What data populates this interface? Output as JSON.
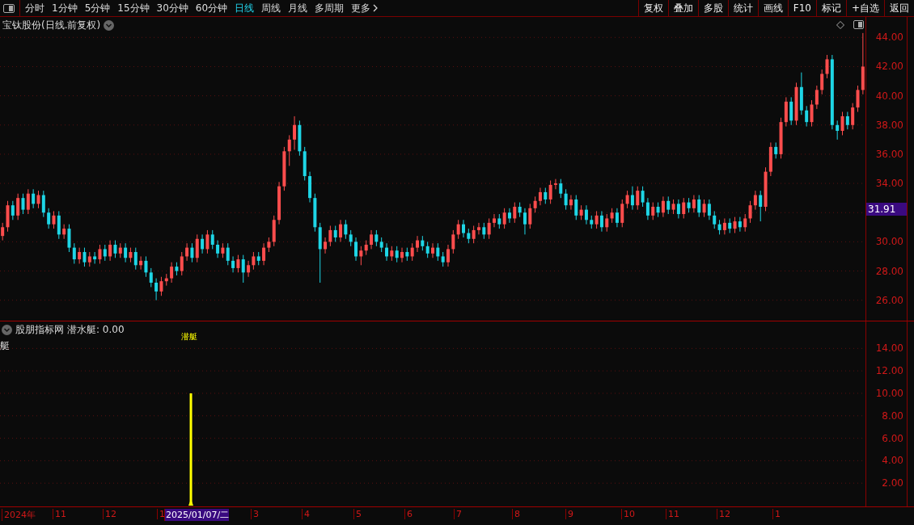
{
  "toolbar": {
    "periods": [
      {
        "label": "分时",
        "selected": false
      },
      {
        "label": "1分钟",
        "selected": false
      },
      {
        "label": "5分钟",
        "selected": false
      },
      {
        "label": "15分钟",
        "selected": false
      },
      {
        "label": "30分钟",
        "selected": false
      },
      {
        "label": "60分钟",
        "selected": false
      },
      {
        "label": "日线",
        "selected": true
      },
      {
        "label": "周线",
        "selected": false
      },
      {
        "label": "月线",
        "selected": false
      },
      {
        "label": "多周期",
        "selected": false
      },
      {
        "label": "更多",
        "selected": false
      }
    ],
    "buttons": [
      "复权",
      "叠加",
      "多股",
      "统计",
      "画线",
      "F10",
      "标记",
      "+自选",
      "返回"
    ]
  },
  "main_chart": {
    "title": "宝钛股份(日线.前复权)",
    "price_tag": "31.91",
    "chart_data": {
      "type": "candlestick",
      "grid": true,
      "ylim": [
        24.6,
        45.4
      ],
      "categories": [
        null,
        null,
        null,
        null,
        null,
        null,
        null,
        null,
        null,
        null,
        null,
        null,
        null,
        null,
        null,
        null,
        null,
        null,
        null,
        null,
        null,
        null,
        null,
        null,
        null,
        null,
        null,
        null,
        null,
        null,
        null,
        null,
        null,
        null,
        null,
        null,
        null,
        null,
        null,
        null,
        null,
        null,
        null,
        null,
        null,
        null,
        null,
        null,
        null,
        null,
        null,
        null,
        null,
        null,
        null,
        null,
        null,
        null,
        null,
        null,
        null,
        null,
        null,
        null,
        null,
        null,
        null,
        null,
        null,
        null,
        null,
        null,
        null,
        null,
        null,
        null,
        null,
        null,
        null,
        null,
        null,
        null,
        null,
        null,
        null,
        null,
        null,
        null,
        null,
        null,
        null,
        null,
        null,
        null,
        null,
        null,
        null,
        null,
        null,
        null,
        null,
        null,
        null,
        null,
        null,
        null,
        null,
        null,
        null,
        null,
        null,
        null,
        null,
        null,
        null,
        null,
        null,
        null,
        null,
        null,
        null,
        null,
        null,
        null,
        null,
        null,
        null,
        null,
        null,
        null,
        null,
        null,
        null,
        null,
        null,
        null,
        null,
        null,
        null,
        null,
        null,
        null,
        null,
        null,
        null,
        null,
        null,
        null,
        null,
        null,
        null,
        null,
        null,
        null,
        null,
        null,
        null,
        null,
        null,
        null,
        null,
        null,
        null,
        null,
        null,
        null,
        null,
        null,
        null
      ],
      "yticks": [
        {
          "value": 44,
          "label": "44.00"
        },
        {
          "value": 42,
          "label": "42.00"
        },
        {
          "value": 40,
          "label": "40.00"
        },
        {
          "value": 38,
          "label": "38.00"
        },
        {
          "value": 36,
          "label": "36.00"
        },
        {
          "value": 34,
          "label": "34.00"
        },
        {
          "value": 30,
          "label": "30.00"
        },
        {
          "value": 28,
          "label": "28.00"
        },
        {
          "value": 26,
          "label": "26.00"
        }
      ],
      "ohlc": [
        [
          30.4,
          31.3,
          30.1,
          31.0
        ],
        [
          31.0,
          32.8,
          30.7,
          32.5
        ],
        [
          32.5,
          32.8,
          31.5,
          31.8
        ],
        [
          31.8,
          33.3,
          31.5,
          33.0
        ],
        [
          33.0,
          33.3,
          31.9,
          32.2
        ],
        [
          32.2,
          33.6,
          31.9,
          33.3
        ],
        [
          33.3,
          33.6,
          32.3,
          32.6
        ],
        [
          32.6,
          33.5,
          32.3,
          33.2
        ],
        [
          33.2,
          33.5,
          31.7,
          32.0
        ],
        [
          32.0,
          32.3,
          30.9,
          31.2
        ],
        [
          31.2,
          32.1,
          30.9,
          31.8
        ],
        [
          31.8,
          32.1,
          30.2,
          30.5
        ],
        [
          30.5,
          31.2,
          30.2,
          30.9
        ],
        [
          30.9,
          31.2,
          29.3,
          29.6
        ],
        [
          29.6,
          29.9,
          28.5,
          28.8
        ],
        [
          28.8,
          29.6,
          28.5,
          29.3
        ],
        [
          29.3,
          29.6,
          28.3,
          28.6
        ],
        [
          28.6,
          29.3,
          28.3,
          29.0
        ],
        [
          29.0,
          29.3,
          28.5,
          28.8
        ],
        [
          28.8,
          29.8,
          28.5,
          29.5
        ],
        [
          29.5,
          29.8,
          28.7,
          29.0
        ],
        [
          29.0,
          30.1,
          28.7,
          29.8
        ],
        [
          29.8,
          30.1,
          28.9,
          29.2
        ],
        [
          29.2,
          29.9,
          28.9,
          29.6
        ],
        [
          29.6,
          29.9,
          28.6,
          28.9
        ],
        [
          28.9,
          29.6,
          28.6,
          29.3
        ],
        [
          29.3,
          29.6,
          28.1,
          28.4
        ],
        [
          28.4,
          29.0,
          28.1,
          28.7
        ],
        [
          28.7,
          29.0,
          27.6,
          27.9
        ],
        [
          27.9,
          28.2,
          26.9,
          27.2
        ],
        [
          27.2,
          27.5,
          26.0,
          26.6
        ],
        [
          26.6,
          27.6,
          26.3,
          27.3
        ],
        [
          27.3,
          27.8,
          27.0,
          27.5
        ],
        [
          27.5,
          28.6,
          27.2,
          28.3
        ],
        [
          28.3,
          28.6,
          27.7,
          28.0
        ],
        [
          28.0,
          29.3,
          27.7,
          29.0
        ],
        [
          29.0,
          29.9,
          28.7,
          29.6
        ],
        [
          29.6,
          29.9,
          28.6,
          28.9
        ],
        [
          28.9,
          30.5,
          28.6,
          30.2
        ],
        [
          30.2,
          30.5,
          29.2,
          29.5
        ],
        [
          29.5,
          30.8,
          29.2,
          30.5
        ],
        [
          30.5,
          30.8,
          29.5,
          29.8
        ],
        [
          29.8,
          30.1,
          28.9,
          29.2
        ],
        [
          29.2,
          29.9,
          28.9,
          29.6
        ],
        [
          29.6,
          29.9,
          28.4,
          28.7
        ],
        [
          28.7,
          29.0,
          27.9,
          28.2
        ],
        [
          28.2,
          29.1,
          27.9,
          28.8
        ],
        [
          28.8,
          29.1,
          27.2,
          27.9
        ],
        [
          27.9,
          28.7,
          27.6,
          28.4
        ],
        [
          28.4,
          29.3,
          28.1,
          29.0
        ],
        [
          29.0,
          29.3,
          28.4,
          28.7
        ],
        [
          28.7,
          29.9,
          28.4,
          29.6
        ],
        [
          29.6,
          30.3,
          29.3,
          30.0
        ],
        [
          30.0,
          31.8,
          29.7,
          31.5
        ],
        [
          31.5,
          34.1,
          31.2,
          33.8
        ],
        [
          33.8,
          36.5,
          33.5,
          36.2
        ],
        [
          36.2,
          37.3,
          35.2,
          37.0
        ],
        [
          37.0,
          38.6,
          36.3,
          38.0
        ],
        [
          38.0,
          38.3,
          35.9,
          36.2
        ],
        [
          36.2,
          36.5,
          34.2,
          34.5
        ],
        [
          34.5,
          34.8,
          32.7,
          33.0
        ],
        [
          33.0,
          33.3,
          30.7,
          31.0
        ],
        [
          31.0,
          31.3,
          27.2,
          29.5
        ],
        [
          29.5,
          30.3,
          29.2,
          30.0
        ],
        [
          30.0,
          31.1,
          29.7,
          30.8
        ],
        [
          30.8,
          31.1,
          30.0,
          30.3
        ],
        [
          30.3,
          31.5,
          30.0,
          31.2
        ],
        [
          31.2,
          31.5,
          30.2,
          30.5
        ],
        [
          30.5,
          30.8,
          29.7,
          30.0
        ],
        [
          30.0,
          30.3,
          28.7,
          29.0
        ],
        [
          29.0,
          29.7,
          28.4,
          29.4
        ],
        [
          29.4,
          30.1,
          29.1,
          29.8
        ],
        [
          29.8,
          30.8,
          29.5,
          30.5
        ],
        [
          30.5,
          30.8,
          29.7,
          30.0
        ],
        [
          30.0,
          30.3,
          29.3,
          29.6
        ],
        [
          29.6,
          29.9,
          28.7,
          29.0
        ],
        [
          29.0,
          29.7,
          28.7,
          29.4
        ],
        [
          29.4,
          29.7,
          28.6,
          28.9
        ],
        [
          28.9,
          29.6,
          28.6,
          29.3
        ],
        [
          29.3,
          29.6,
          28.7,
          29.0
        ],
        [
          29.0,
          29.9,
          28.7,
          29.6
        ],
        [
          29.6,
          30.4,
          29.3,
          30.1
        ],
        [
          30.1,
          30.4,
          29.4,
          29.7
        ],
        [
          29.7,
          30.0,
          28.9,
          29.2
        ],
        [
          29.2,
          29.9,
          28.9,
          29.6
        ],
        [
          29.6,
          29.9,
          28.7,
          29.0
        ],
        [
          29.0,
          29.3,
          28.3,
          28.6
        ],
        [
          28.6,
          29.8,
          28.3,
          29.5
        ],
        [
          29.5,
          30.8,
          29.2,
          30.5
        ],
        [
          30.5,
          31.5,
          30.2,
          31.2
        ],
        [
          31.2,
          31.5,
          30.3,
          30.6
        ],
        [
          30.6,
          30.9,
          29.9,
          30.2
        ],
        [
          30.2,
          31.1,
          29.9,
          30.8
        ],
        [
          30.8,
          31.3,
          30.5,
          31.0
        ],
        [
          31.0,
          31.3,
          30.2,
          30.5
        ],
        [
          30.5,
          31.6,
          30.2,
          31.3
        ],
        [
          31.3,
          31.9,
          31.0,
          31.6
        ],
        [
          31.6,
          31.9,
          30.9,
          31.2
        ],
        [
          31.2,
          32.3,
          30.9,
          32.0
        ],
        [
          32.0,
          32.3,
          31.3,
          31.6
        ],
        [
          31.6,
          32.7,
          31.3,
          32.4
        ],
        [
          32.4,
          32.7,
          31.7,
          32.0
        ],
        [
          32.0,
          32.3,
          30.5,
          31.2
        ],
        [
          31.2,
          32.6,
          30.9,
          32.3
        ],
        [
          32.3,
          33.1,
          32.0,
          32.8
        ],
        [
          32.8,
          33.7,
          32.5,
          33.4
        ],
        [
          33.4,
          33.7,
          32.6,
          32.9
        ],
        [
          32.9,
          34.2,
          32.6,
          33.9
        ],
        [
          33.9,
          34.3,
          33.6,
          34.0
        ],
        [
          34.0,
          34.3,
          33.0,
          33.3
        ],
        [
          33.3,
          33.6,
          32.2,
          32.5
        ],
        [
          32.5,
          33.2,
          32.2,
          32.9
        ],
        [
          32.9,
          33.2,
          31.5,
          31.8
        ],
        [
          31.8,
          32.5,
          31.5,
          32.2
        ],
        [
          32.2,
          32.5,
          31.2,
          31.5
        ],
        [
          31.5,
          31.8,
          30.9,
          31.2
        ],
        [
          31.2,
          32.1,
          30.9,
          31.8
        ],
        [
          31.8,
          32.1,
          30.7,
          31.0
        ],
        [
          31.0,
          31.9,
          30.7,
          31.6
        ],
        [
          31.6,
          32.3,
          31.3,
          32.0
        ],
        [
          32.0,
          32.3,
          31.0,
          31.3
        ],
        [
          31.3,
          32.9,
          31.0,
          32.6
        ],
        [
          32.6,
          33.5,
          32.3,
          33.2
        ],
        [
          33.2,
          33.8,
          32.2,
          32.5
        ],
        [
          32.5,
          33.8,
          32.2,
          33.5
        ],
        [
          33.5,
          33.8,
          32.4,
          32.7
        ],
        [
          32.7,
          33.0,
          31.5,
          31.8
        ],
        [
          31.8,
          32.7,
          31.5,
          32.4
        ],
        [
          32.4,
          32.7,
          31.7,
          32.0
        ],
        [
          32.0,
          33.1,
          31.7,
          32.8
        ],
        [
          32.8,
          33.1,
          31.9,
          32.2
        ],
        [
          32.2,
          32.9,
          31.9,
          32.6
        ],
        [
          32.6,
          32.9,
          31.6,
          31.9
        ],
        [
          31.9,
          33.0,
          31.6,
          32.7
        ],
        [
          32.7,
          33.0,
          32.0,
          32.3
        ],
        [
          32.3,
          33.2,
          32.0,
          32.9
        ],
        [
          32.9,
          33.2,
          31.7,
          32.0
        ],
        [
          32.0,
          32.9,
          31.7,
          32.6
        ],
        [
          32.6,
          32.9,
          31.5,
          31.8
        ],
        [
          31.8,
          32.1,
          30.9,
          31.2
        ],
        [
          31.2,
          31.5,
          30.5,
          30.8
        ],
        [
          30.8,
          31.6,
          30.5,
          31.3
        ],
        [
          31.3,
          31.6,
          30.6,
          30.9
        ],
        [
          30.9,
          31.7,
          30.6,
          31.4
        ],
        [
          31.4,
          31.7,
          30.7,
          31.0
        ],
        [
          31.0,
          31.9,
          30.7,
          31.6
        ],
        [
          31.6,
          32.8,
          31.3,
          32.5
        ],
        [
          32.5,
          33.5,
          32.2,
          33.2
        ],
        [
          33.2,
          33.5,
          31.4,
          32.4
        ],
        [
          32.4,
          35.1,
          32.1,
          34.8
        ],
        [
          34.8,
          36.8,
          34.5,
          36.5
        ],
        [
          36.5,
          36.8,
          35.7,
          36.0
        ],
        [
          36.0,
          38.5,
          35.7,
          38.2
        ],
        [
          38.2,
          39.9,
          37.9,
          39.6
        ],
        [
          39.6,
          39.9,
          38.0,
          38.3
        ],
        [
          38.3,
          40.9,
          38.0,
          40.6
        ],
        [
          40.6,
          41.6,
          38.7,
          39.0
        ],
        [
          39.0,
          39.3,
          37.9,
          38.2
        ],
        [
          38.2,
          39.7,
          37.9,
          39.4
        ],
        [
          39.4,
          40.7,
          39.1,
          40.4
        ],
        [
          40.4,
          41.8,
          40.1,
          41.5
        ],
        [
          41.5,
          42.8,
          41.2,
          42.5
        ],
        [
          42.5,
          42.8,
          37.7,
          38.0
        ],
        [
          38.0,
          38.3,
          37.0,
          37.6
        ],
        [
          37.6,
          38.9,
          37.3,
          38.6
        ],
        [
          38.6,
          38.9,
          37.7,
          38.0
        ],
        [
          38.0,
          39.5,
          37.7,
          39.2
        ],
        [
          39.2,
          40.7,
          38.9,
          40.4
        ],
        [
          40.4,
          44.3,
          40.1,
          42.0
        ]
      ]
    }
  },
  "indicator": {
    "title": "股朋指标网",
    "reading": "潜水艇: 0.00",
    "side_label": "艇",
    "signal_label": "潜艇",
    "chart_data": {
      "type": "bar",
      "categories": [
        null,
        null,
        null,
        null,
        null,
        null,
        null,
        null,
        null,
        null,
        null,
        null,
        null,
        null,
        null,
        null,
        null,
        null,
        null,
        null,
        null,
        null,
        null,
        null,
        null,
        null,
        null,
        null,
        null,
        null,
        null,
        null,
        null,
        null,
        null,
        null,
        null,
        null,
        null,
        null,
        null,
        null,
        null,
        null,
        null,
        null,
        null,
        null,
        null,
        null,
        null,
        null,
        null,
        null,
        null,
        null,
        null,
        null,
        null,
        null,
        null,
        null,
        null,
        null,
        null,
        null,
        null,
        null,
        null,
        null,
        null,
        null,
        null,
        null,
        null,
        null,
        null,
        null,
        null,
        null,
        null,
        null,
        null,
        null,
        null,
        null,
        null,
        null,
        null,
        null,
        null,
        null,
        null,
        null,
        null,
        null,
        null,
        null,
        null,
        null,
        null,
        null,
        null,
        null,
        null,
        null,
        null,
        null,
        null,
        null,
        null,
        null,
        null,
        null,
        null,
        null,
        null,
        null,
        null,
        null,
        null,
        null,
        null,
        null,
        null,
        null,
        null,
        null,
        null,
        null,
        null,
        null,
        null,
        null,
        null,
        null,
        null,
        null,
        null,
        null,
        null,
        null,
        null,
        null,
        null,
        null,
        null,
        null,
        null,
        null,
        null,
        null,
        null,
        null,
        null,
        null,
        null,
        null,
        null,
        null,
        null,
        null,
        null,
        null,
        null,
        null,
        null,
        null,
        null,
        null
      ],
      "values": [
        0,
        0,
        0,
        0,
        0,
        0,
        0,
        0,
        0,
        0,
        0,
        0,
        0,
        0,
        0,
        0,
        0,
        0,
        0,
        0,
        0,
        0,
        0,
        0,
        0,
        0,
        0,
        0,
        0,
        0,
        0,
        0,
        0,
        0,
        0,
        0,
        0,
        10,
        0,
        0,
        0,
        0,
        0,
        0,
        0,
        0,
        0,
        0,
        0,
        0,
        0,
        0,
        0,
        0,
        0,
        0,
        0,
        0,
        0,
        0,
        0,
        0,
        0,
        0,
        0,
        0,
        0,
        0,
        0,
        0,
        0,
        0,
        0,
        0,
        0,
        0,
        0,
        0,
        0,
        0,
        0,
        0,
        0,
        0,
        0,
        0,
        0,
        0,
        0,
        0,
        0,
        0,
        0,
        0,
        0,
        0,
        0,
        0,
        0,
        0,
        0,
        0,
        0,
        0,
        0,
        0,
        0,
        0,
        0,
        0,
        0,
        0,
        0,
        0,
        0,
        0,
        0,
        0,
        0,
        0,
        0,
        0,
        0,
        0,
        0,
        0,
        0,
        0,
        0,
        0,
        0,
        0,
        0,
        0,
        0,
        0,
        0,
        0,
        0,
        0,
        0,
        0,
        0,
        0,
        0,
        0,
        0,
        0,
        0,
        0,
        0,
        0,
        0,
        0,
        0,
        0,
        0,
        0,
        0,
        0,
        0,
        0,
        0,
        0,
        0,
        0,
        0,
        0,
        0,
        0
      ],
      "grid": true,
      "ylim": [
        0,
        16.4
      ],
      "yticks": [
        {
          "value": 14,
          "label": "14.00"
        },
        {
          "value": 12,
          "label": "12.00"
        },
        {
          "value": 10,
          "label": "10.00"
        },
        {
          "value": 8,
          "label": "8.00"
        },
        {
          "value": 6,
          "label": "6.00"
        },
        {
          "value": 4,
          "label": "4.00"
        },
        {
          "value": 2,
          "label": "2.00"
        }
      ]
    }
  },
  "time_axis": {
    "labels": [
      {
        "label": "2024年",
        "selected": false
      },
      {
        "label": "11",
        "selected": false
      },
      {
        "label": "12",
        "selected": false
      },
      {
        "label": "1",
        "selected": false
      },
      {
        "label": "2025/01/07/二",
        "selected": true
      },
      {
        "label": "3",
        "selected": false
      },
      {
        "label": "4",
        "selected": false
      },
      {
        "label": "5",
        "selected": false
      },
      {
        "label": "6",
        "selected": false
      },
      {
        "label": "7",
        "selected": false
      },
      {
        "label": "8",
        "selected": false
      },
      {
        "label": "9",
        "selected": false
      },
      {
        "label": "10",
        "selected": false
      },
      {
        "label": "11",
        "selected": false
      },
      {
        "label": "12",
        "selected": false
      },
      {
        "label": "1",
        "selected": false
      }
    ]
  }
}
